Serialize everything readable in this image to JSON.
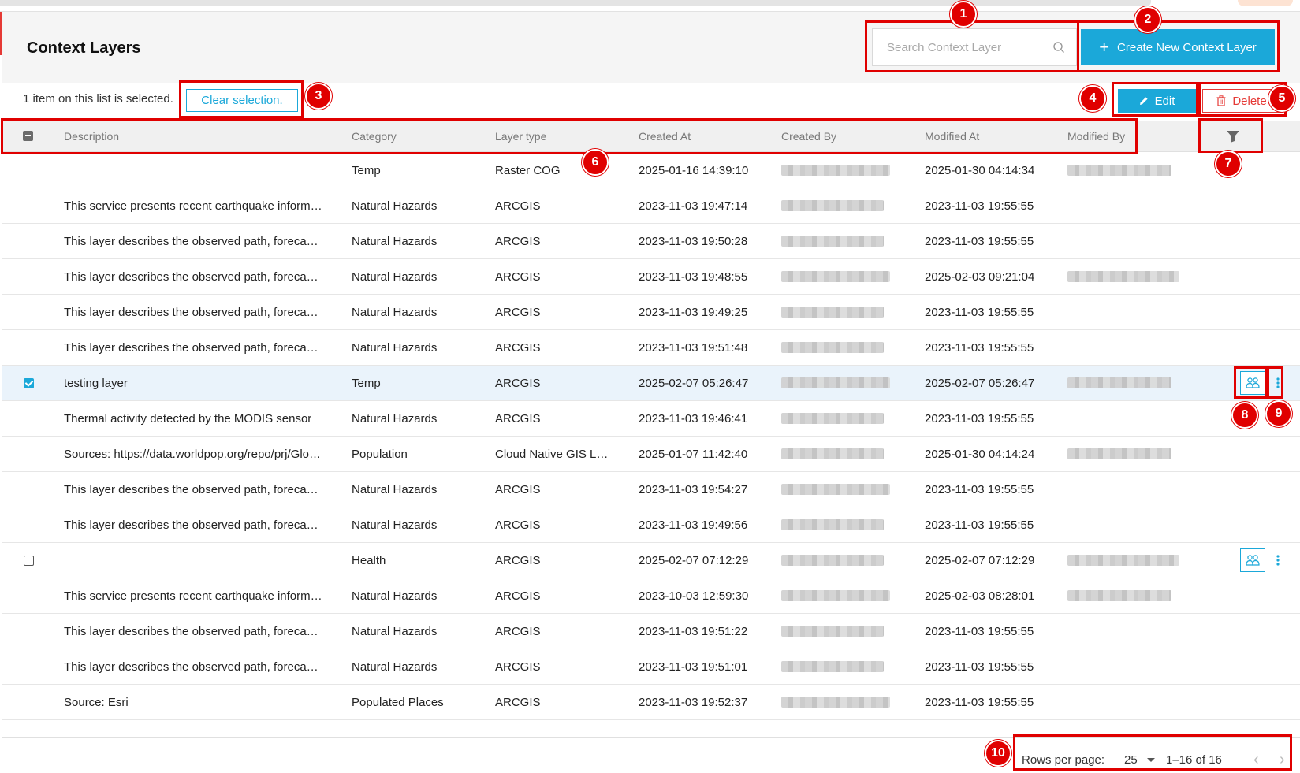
{
  "page": {
    "title": "Context Layers"
  },
  "search": {
    "placeholder": "Search Context Layer",
    "icon": "search-icon"
  },
  "actions": {
    "create_label": "Create New Context Layer",
    "edit_label": "Edit",
    "delete_label": "Delete"
  },
  "selection": {
    "text": "1 item on this list is selected.",
    "clear_label": "Clear selection."
  },
  "table": {
    "columns": [
      "Description",
      "Category",
      "Layer type",
      "Created At",
      "Created By",
      "Modified At",
      "Modified By"
    ],
    "rows": [
      {
        "description": "",
        "category": "Temp",
        "layer_type": "Raster COG",
        "created_at": "2025-01-16 14:39:10",
        "modified_at": "2025-01-30 04:14:34",
        "modified_by_shown": true
      },
      {
        "description": "This service presents recent earthquake information from the USGS",
        "category": "Natural Hazards",
        "layer_type": "ARCGIS",
        "created_at": "2023-11-03 19:47:14",
        "modified_at": "2023-11-03 19:55:55",
        "modified_by_shown": false
      },
      {
        "description": "This layer describes the observed path, forecast track",
        "category": "Natural Hazards",
        "layer_type": "ARCGIS",
        "created_at": "2023-11-03 19:50:28",
        "modified_at": "2023-11-03 19:55:55",
        "modified_by_shown": false
      },
      {
        "description": "This layer describes the observed path, forecast track",
        "category": "Natural Hazards",
        "layer_type": "ARCGIS",
        "created_at": "2023-11-03 19:48:55",
        "modified_at": "2025-02-03 09:21:04",
        "modified_by_shown": true
      },
      {
        "description": "This layer describes the observed path, forecast track",
        "category": "Natural Hazards",
        "layer_type": "ARCGIS",
        "created_at": "2023-11-03 19:49:25",
        "modified_at": "2023-11-03 19:55:55",
        "modified_by_shown": false
      },
      {
        "description": "This layer describes the observed path, forecast track",
        "category": "Natural Hazards",
        "layer_type": "ARCGIS",
        "created_at": "2023-11-03 19:51:48",
        "modified_at": "2023-11-03 19:55:55",
        "modified_by_shown": false
      },
      {
        "description": "testing layer",
        "category": "Temp",
        "layer_type": "ARCGIS",
        "created_at": "2025-02-07 05:26:47",
        "modified_at": "2025-02-07 05:26:47",
        "modified_by_shown": true,
        "selected": true,
        "actions": true
      },
      {
        "description": "Thermal activity detected by the MODIS sensor",
        "category": "Natural Hazards",
        "layer_type": "ARCGIS",
        "created_at": "2023-11-03 19:46:41",
        "modified_at": "2023-11-03 19:55:55",
        "modified_by_shown": false
      },
      {
        "description": "Sources: https://data.worldpop.org/repo/prj/Global",
        "category": "Population",
        "layer_type": "Cloud Native GIS Layer",
        "created_at": "2025-01-07 11:42:40",
        "modified_at": "2025-01-30 04:14:24",
        "modified_by_shown": true
      },
      {
        "description": "This layer describes the observed path, forecast track",
        "category": "Natural Hazards",
        "layer_type": "ARCGIS",
        "created_at": "2023-11-03 19:54:27",
        "modified_at": "2023-11-03 19:55:55",
        "modified_by_shown": false
      },
      {
        "description": "This layer describes the observed path, forecast track",
        "category": "Natural Hazards",
        "layer_type": "ARCGIS",
        "created_at": "2023-11-03 19:49:56",
        "modified_at": "2023-11-03 19:55:55",
        "modified_by_shown": false
      },
      {
        "description": "",
        "category": "Health",
        "layer_type": "ARCGIS",
        "created_at": "2025-02-07 07:12:29",
        "modified_at": "2025-02-07 07:12:29",
        "modified_by_shown": true,
        "checkbox": true,
        "actions": true
      },
      {
        "description": "This service presents recent earthquake information from the USGS",
        "category": "Natural Hazards",
        "layer_type": "ARCGIS",
        "created_at": "2023-10-03 12:59:30",
        "modified_at": "2025-02-03 08:28:01",
        "modified_by_shown": true
      },
      {
        "description": "This layer describes the observed path, forecast track",
        "category": "Natural Hazards",
        "layer_type": "ARCGIS",
        "created_at": "2023-11-03 19:51:22",
        "modified_at": "2023-11-03 19:55:55",
        "modified_by_shown": false
      },
      {
        "description": "This layer describes the observed path, forecast track",
        "category": "Natural Hazards",
        "layer_type": "ARCGIS",
        "created_at": "2023-11-03 19:51:01",
        "modified_at": "2023-11-03 19:55:55",
        "modified_by_shown": false
      },
      {
        "description": "Source: Esri",
        "category": "Populated Places",
        "layer_type": "ARCGIS",
        "created_at": "2023-11-03 19:52:37",
        "modified_at": "2023-11-03 19:55:55",
        "modified_by_shown": false
      }
    ]
  },
  "pagination": {
    "rows_per_page_label": "Rows per page:",
    "rows_per_page_value": "25",
    "range": "1–16 of 16"
  },
  "annotations": [
    "1",
    "2",
    "3",
    "4",
    "5",
    "6",
    "7",
    "8",
    "9",
    "10"
  ],
  "colors": {
    "primary": "#1ba8d9",
    "danger": "#e53935",
    "annotation": "#e00000",
    "selected_row": "#eaf3fb"
  }
}
